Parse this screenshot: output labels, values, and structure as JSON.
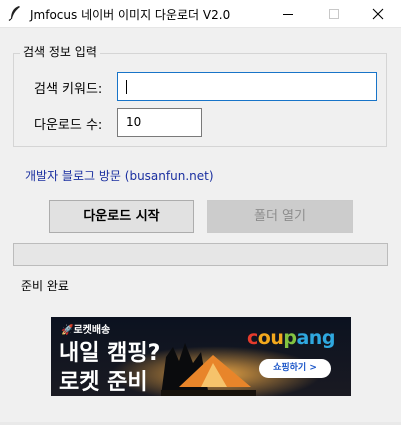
{
  "window": {
    "title": "Jmfocus 네이버 이미지 다운로더 V2.0"
  },
  "search_group": {
    "legend": "검색 정보 입력",
    "keyword_label": "검색 키워드:",
    "keyword_value": "",
    "count_label": "다운로드 수:",
    "count_value": "10"
  },
  "blog_link": "개발자 블로그 방문 (busanfun.net)",
  "buttons": {
    "start": "다운로드 시작",
    "open_folder": "폴더 열기"
  },
  "progress": {
    "value": 0
  },
  "status_text": "준비 완료",
  "banner": {
    "tagline": "🚀로켓배송",
    "headline_line1": "내일 캠핑?",
    "headline_line2": "로켓 준비",
    "logo_letters": [
      "c",
      "o",
      "u",
      "p",
      "a",
      "n",
      "g"
    ],
    "logo_colors": [
      "#e53b2c",
      "#f2a81d",
      "#f2a81d",
      "#82c341",
      "#2fa8df",
      "#2fa8df",
      "#2fa8df"
    ],
    "cta": "쇼핑하기 >"
  },
  "colors": {
    "window_bg": "#f0f0f0",
    "focus_border": "#1874c8",
    "link": "#1a2fa0"
  }
}
